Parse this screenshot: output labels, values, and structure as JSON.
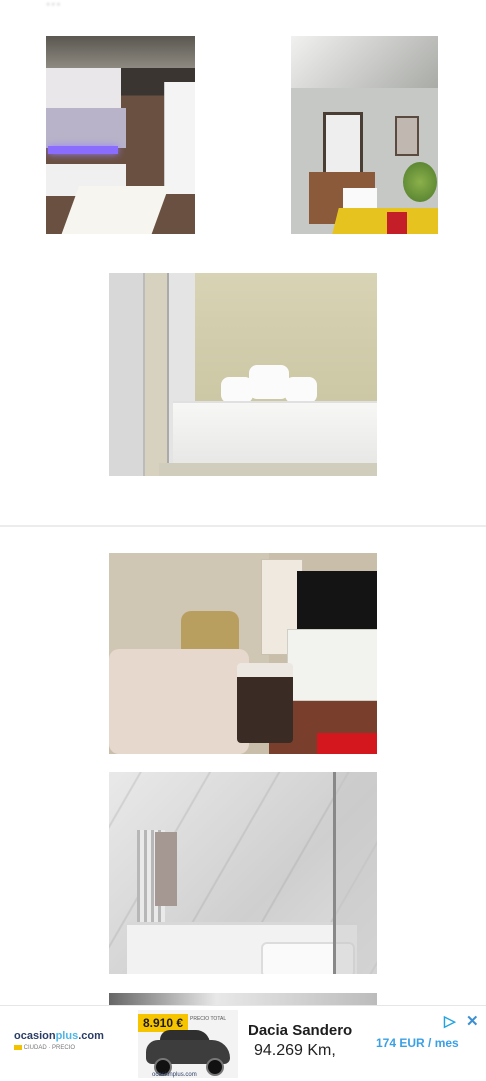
{
  "page": {
    "heading_fragment": "..."
  },
  "gallery": {
    "photos": [
      {
        "name": "kitchen-photo"
      },
      {
        "name": "dining-photo"
      },
      {
        "name": "bedroom-photo"
      },
      {
        "name": "living-room-photo"
      },
      {
        "name": "bathroom-photo"
      }
    ]
  },
  "ad": {
    "brand": "ocasion",
    "brand_accent": "plus",
    "brand_suffix": ".com",
    "brand_sub": "CIUDAD · PRECIO",
    "price": "8.910 €",
    "price_note": "PRECIO TOTAL",
    "car_footer": "ocasionplus.com",
    "title": "Dacia Sandero",
    "mileage": "94.269 Km,",
    "monthly": "174 EUR / mes",
    "choices_icon": "ad-choices-icon",
    "close_icon": "close-icon",
    "accent_color": "#3aa0e6",
    "price_color": "#f7c500"
  }
}
